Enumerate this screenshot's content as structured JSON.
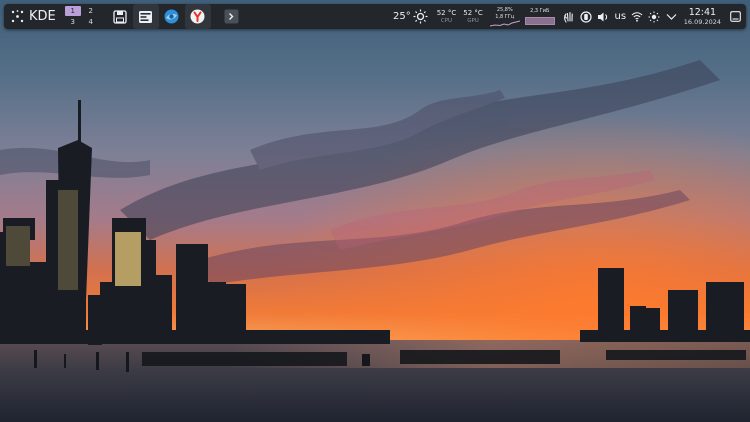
{
  "launcher": {
    "label": "KDE"
  },
  "pager": {
    "desktops": [
      "1",
      "2",
      "3",
      "4"
    ],
    "active": "1"
  },
  "taskbar": {
    "items": [
      "save-manager",
      "system-monitor",
      "browser",
      "yandex-browser",
      "terminal"
    ]
  },
  "weather": {
    "temperature": "25°",
    "icon": "sun-icon"
  },
  "sensors": [
    {
      "value": "52 °C",
      "label": "CPU"
    },
    {
      "value": "52 °C",
      "label": "GPU"
    }
  ],
  "network": {
    "usage": "25,8%",
    "frequency": "1,8 ГГц"
  },
  "memory": {
    "value": "2,3 ГиБ"
  },
  "tray": {
    "keyboard_layout": "us"
  },
  "clock": {
    "time": "12:41",
    "date": "16.09.2024"
  },
  "colors": {
    "panel": "#23262b",
    "accent": "#b9a0d8",
    "sky_top": "#3f5f7a",
    "sunset": "#f26b2f"
  }
}
